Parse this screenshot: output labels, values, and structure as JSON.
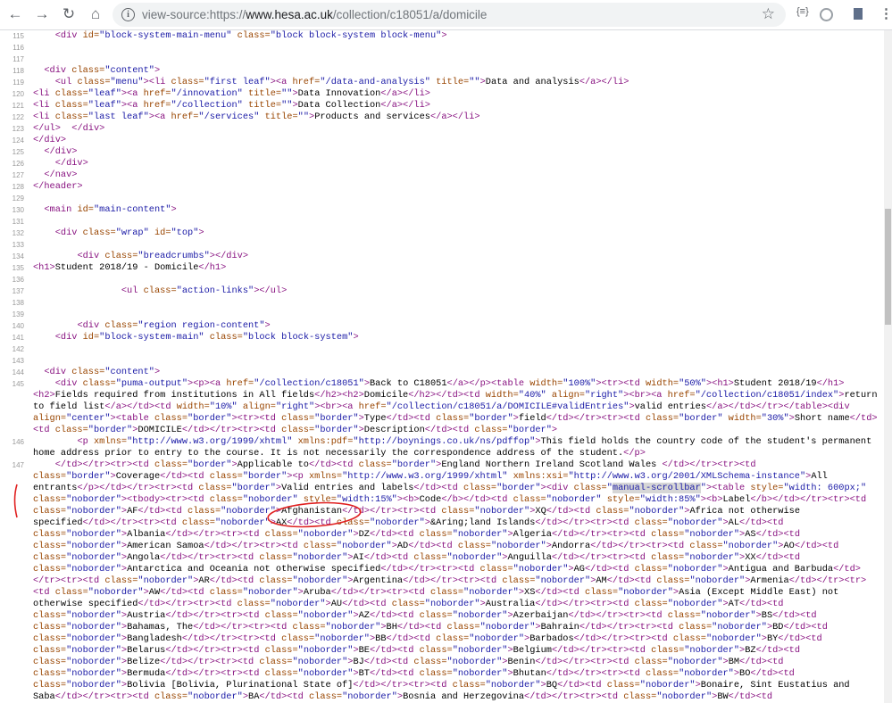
{
  "browser": {
    "url_prefix": "view-source:https://",
    "url_host": "www.hesa.ac.uk",
    "url_path": "/collection/c18051/a/domicile",
    "icons": [
      "back-icon",
      "forward-icon",
      "reload-icon",
      "home-icon",
      "info-icon",
      "star-icon",
      "extension-icon",
      "profile-icon",
      "menu-icon"
    ]
  },
  "highlight_word": "manual-scrollbar",
  "colors": {
    "tag": "#881280",
    "attr": "#994500",
    "value": "#1a1aa6",
    "annotation": "#e02020"
  },
  "rows": [
    {
      "n": "115",
      "t": "    <div id=\"block-system-main-menu\" class=\"block block-system block-menu\">"
    },
    {
      "n": "116",
      "t": ""
    },
    {
      "n": "117",
      "t": ""
    },
    {
      "n": "118",
      "t": "  <div class=\"content\">"
    },
    {
      "n": "119",
      "t": "    <ul class=\"menu\"><li class=\"first leaf\"><a href=\"/data-and-analysis\" title=\"\">Data and analysis</a></li>"
    },
    {
      "n": "120",
      "t": "<li class=\"leaf\"><a href=\"/innovation\" title=\"\">Data Innovation</a></li>"
    },
    {
      "n": "121",
      "t": "<li class=\"leaf\"><a href=\"/collection\" title=\"\">Data Collection</a></li>"
    },
    {
      "n": "122",
      "t": "<li class=\"last leaf\"><a href=\"/services\" title=\"\">Products and services</a></li>"
    },
    {
      "n": "123",
      "t": "</ul>  </div>"
    },
    {
      "n": "124",
      "t": "</div>"
    },
    {
      "n": "125",
      "t": "  </div>"
    },
    {
      "n": "126",
      "t": "    </div>"
    },
    {
      "n": "127",
      "t": "  </nav>"
    },
    {
      "n": "128",
      "t": "</header>"
    },
    {
      "n": "129",
      "t": ""
    },
    {
      "n": "130",
      "t": "  <main id=\"main-content\">"
    },
    {
      "n": "131",
      "t": ""
    },
    {
      "n": "132",
      "t": "    <div class=\"wrap\" id=\"top\">"
    },
    {
      "n": "133",
      "t": ""
    },
    {
      "n": "134",
      "t": "        <div class=\"breadcrumbs\"></div>"
    },
    {
      "n": "135",
      "t": "<h1>Student 2018/19 - Domicile</h1>"
    },
    {
      "n": "136",
      "t": ""
    },
    {
      "n": "137",
      "t": "                <ul class=\"action-links\"></ul>"
    },
    {
      "n": "138",
      "t": ""
    },
    {
      "n": "139",
      "t": ""
    },
    {
      "n": "140",
      "t": "        <div class=\"region region-content\">"
    },
    {
      "n": "141",
      "t": "    <div id=\"block-system-main\" class=\"block block-system\">"
    },
    {
      "n": "142",
      "t": ""
    },
    {
      "n": "143",
      "t": ""
    },
    {
      "n": "144",
      "t": "  <div class=\"content\">"
    },
    {
      "n": "145",
      "t": "    <div class=\"puma-output\"><p><a href=\"/collection/c18051\">Back to C18051</a></p><table width=\"100%\"><tr><td width=\"50%\"><h1>Student 2018/19</h1>"
    },
    {
      "n": "",
      "t": "<h2>Fields required from institutions in All fields</h2><h2>Domicile</h2></td><td width=\"40%\" align=\"right\"><br><a href=\"/collection/c18051/index\">return"
    },
    {
      "n": "",
      "t": "to field list</a></td><td width=\"10%\" align=\"right\"><br><a href=\"/collection/c18051/a/DOMICILE#validEntries\">valid entries</a></td></tr></table><div"
    },
    {
      "n": "",
      "t": "align=\"center\"><table class=\"border\"><tr><td class=\"border\">Type</td><td class=\"border\">field</td></tr><tr><td class=\"border\" width=\"30%\">Short name</td>"
    },
    {
      "n": "",
      "t": "<td class=\"border\">DOMICILE</td></tr><tr><td class=\"border\">Description</td><td class=\"border\">"
    },
    {
      "n": "146",
      "t": "        <p xmlns=\"http://www.w3.org/1999/xhtml\" xmlns:pdf=\"http://boynings.co.uk/ns/pdffop\">This field holds the country code of the student's permanent"
    },
    {
      "n": "",
      "t": "home address prior to entry to the course. It is not necessarily the correspondence address of the student.</p>"
    },
    {
      "n": "147",
      "t": "    </td></tr><tr><td class=\"border\">Applicable to</td><td class=\"border\">England Northern Ireland Scotland Wales </td></tr><tr><td"
    },
    {
      "n": "",
      "t": "class=\"border\">Coverage</td><td class=\"border\"><p xmlns=\"http://www.w3.org/1999/xhtml\" xmlns:xsi=\"http://www.w3.org/2001/XMLSchema-instance\">All"
    },
    {
      "n": "",
      "t": "entrants</p></td></tr><tr><td class=\"border\">Valid entries and labels</td><td class=\"border\"><div class=\"manual-scrollbar\"><table style=\"width: 600px;\""
    },
    {
      "n": "",
      "t": "class=\"noborder\"><tbody><tr><td class=\"noborder\" style=\"width:15%\"><b>Code</b></td><td class=\"noborder\" style=\"width:85%\"><b>Label</b></td></tr><tr><td"
    },
    {
      "n": "",
      "t": "class=\"noborder\">AF</td><td class=\"noborder\">Afghanistan</td></tr><tr><td class=\"noborder\">XQ</td><td class=\"noborder\">Africa not otherwise"
    },
    {
      "n": "",
      "t": "specified</td></tr><tr><td class=\"noborder\">AX</td><td class=\"noborder\">&Aring;land Islands</td></tr><tr><td class=\"noborder\">AL</td><td"
    },
    {
      "n": "",
      "t": "class=\"noborder\">Albania</td></tr><tr><td class=\"noborder\">DZ</td><td class=\"noborder\">Algeria</td></tr><tr><td class=\"noborder\">AS</td><td"
    },
    {
      "n": "",
      "t": "class=\"noborder\">American Samoa</td></tr><tr><td class=\"noborder\">AD</td><td class=\"noborder\">Andorra</td></tr><tr><td class=\"noborder\">AO</td><td"
    },
    {
      "n": "",
      "t": "class=\"noborder\">Angola</td></tr><tr><td class=\"noborder\">AI</td><td class=\"noborder\">Anguilla</td></tr><tr><td class=\"noborder\">XX</td><td"
    },
    {
      "n": "",
      "t": "class=\"noborder\">Antarctica and Oceania not otherwise specified</td></tr><tr><td class=\"noborder\">AG</td><td class=\"noborder\">Antigua and Barbuda</td>"
    },
    {
      "n": "",
      "t": "</tr><tr><td class=\"noborder\">AR</td><td class=\"noborder\">Argentina</td></tr><tr><td class=\"noborder\">AM</td><td class=\"noborder\">Armenia</td></tr><tr>"
    },
    {
      "n": "",
      "t": "<td class=\"noborder\">AW</td><td class=\"noborder\">Aruba</td></tr><tr><td class=\"noborder\">XS</td><td class=\"noborder\">Asia (Except Middle East) not"
    },
    {
      "n": "",
      "t": "otherwise specified</td></tr><tr><td class=\"noborder\">AU</td><td class=\"noborder\">Australia</td></tr><tr><td class=\"noborder\">AT</td><td"
    },
    {
      "n": "",
      "t": "class=\"noborder\">Austria</td></tr><tr><td class=\"noborder\">AZ</td><td class=\"noborder\">Azerbaijan</td></tr><tr><td class=\"noborder\">BS</td><td"
    },
    {
      "n": "",
      "t": "class=\"noborder\">Bahamas, The</td></tr><tr><td class=\"noborder\">BH</td><td class=\"noborder\">Bahrain</td></tr><tr><td class=\"noborder\">BD</td><td"
    },
    {
      "n": "",
      "t": "class=\"noborder\">Bangladesh</td></tr><tr><td class=\"noborder\">BB</td><td class=\"noborder\">Barbados</td></tr><tr><td class=\"noborder\">BY</td><td"
    },
    {
      "n": "",
      "t": "class=\"noborder\">Belarus</td></tr><tr><td class=\"noborder\">BE</td><td class=\"noborder\">Belgium</td></tr><tr><td class=\"noborder\">BZ</td><td"
    },
    {
      "n": "",
      "t": "class=\"noborder\">Belize</td></tr><tr><td class=\"noborder\">BJ</td><td class=\"noborder\">Benin</td></tr><tr><td class=\"noborder\">BM</td><td"
    },
    {
      "n": "",
      "t": "class=\"noborder\">Bermuda</td></tr><tr><td class=\"noborder\">BT</td><td class=\"noborder\">Bhutan</td></tr><tr><td class=\"noborder\">BO</td><td"
    },
    {
      "n": "",
      "t": "class=\"noborder\">Bolivia [Bolivia, Plurinational State of]</td></tr><tr><td class=\"noborder\">BQ</td><td class=\"noborder\">Bonaire, Sint Eustatius and"
    },
    {
      "n": "",
      "t": "Saba</td></tr><tr><td class=\"noborder\">BA</td><td class=\"noborder\">Bosnia and Herzegovina</td></tr><tr><td class=\"noborder\">BW</td><td"
    }
  ]
}
